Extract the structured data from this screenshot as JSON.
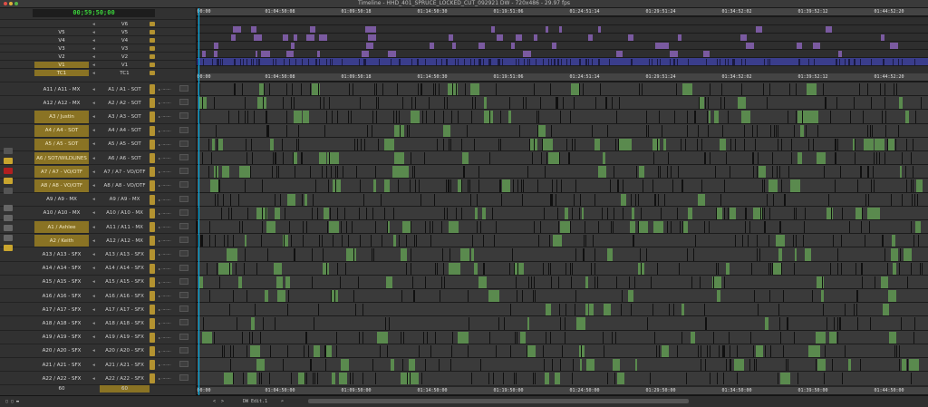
{
  "window": {
    "title": "Timeline - HHD_401_SPRUCE_LOCKED_CUT_092921 DW - 720x486 - 29.97 fps"
  },
  "timecode": "00;59;50;00",
  "ruler_ticks": [
    "00:00",
    "01:04:50:08",
    "01:09:50:18",
    "01:14:50:30",
    "01:19:51:06",
    "01:24:51:14",
    "01:29:51:24",
    "01:34:52:02",
    "01:39:52:12",
    "01:44:52:20"
  ],
  "audio_ruler_ticks": [
    "00:00",
    "01:04:50:08",
    "01:09:50:18",
    "01:14:50:30",
    "01:19:51:06",
    "01:24:51:14",
    "01:29:51:24",
    "01:34:52:02",
    "01:39:52:12",
    "01:44:52:20"
  ],
  "bottom_ruler_ticks": [
    "00:00",
    "01:04:50:00",
    "01:09:50:00",
    "01:14:50:00",
    "01:19:50:00",
    "01:24:50:00",
    "01:29:50:00",
    "01:34:50:00",
    "01:39:50:00",
    "01:44:50:00"
  ],
  "video_tracks": [
    {
      "left": "",
      "right": "V6",
      "gold": false
    },
    {
      "left": "V5",
      "right": "V5",
      "gold": false
    },
    {
      "left": "V4",
      "right": "V4",
      "gold": false
    },
    {
      "left": "V3",
      "right": "V3",
      "gold": false
    },
    {
      "left": "V2",
      "right": "V2",
      "gold": false
    },
    {
      "left": "V1",
      "right": "V1",
      "gold": true
    },
    {
      "left": "TC1",
      "right": "TC1",
      "gold": true
    }
  ],
  "audio_tracks": [
    {
      "left": "A11 / A11 - MX",
      "right": "A1 / A1 - SOT",
      "gold": false,
      "filled": true
    },
    {
      "left": "A12 / A12 - MX",
      "right": "A2 / A2 - SOT",
      "gold": false,
      "filled": true
    },
    {
      "left": "A3 / Justin",
      "right": "A3 / A3 - SOT",
      "gold": true,
      "filled": true
    },
    {
      "left": "A4 / A4 - SOT",
      "right": "A4 / A4 - SOT",
      "gold": true,
      "filled": true
    },
    {
      "left": "A5 / A5 - SOT",
      "right": "A5 / A5 - SOT",
      "gold": true,
      "filled": true
    },
    {
      "left": "A6 / SOT/WILDLINES",
      "right": "A6 / A6 - SOT",
      "gold": true,
      "filled": true
    },
    {
      "left": "A7 / A7 - VO/OTF",
      "right": "A7 / A7 - VO/OTF",
      "gold": true,
      "filled": true
    },
    {
      "left": "A8 / A8 - VO/OTF",
      "right": "A8 / A8 - VO/OTF",
      "gold": true,
      "filled": true
    },
    {
      "left": "A9 / A9 - MX",
      "right": "A9 / A9 - MX",
      "gold": false,
      "filled": true
    },
    {
      "left": "A10 / A10 - MX",
      "right": "A10 / A10 - MX",
      "gold": false,
      "filled": true
    },
    {
      "left": "A1 / Ashlee",
      "right": "A11 / A11 - MX",
      "gold": true,
      "filled": true
    },
    {
      "left": "A2 / Keith",
      "right": "A12 / A12 - MX",
      "gold": true,
      "filled": true
    },
    {
      "left": "A13 / A13 - SFX",
      "right": "A13 / A13 - SFX",
      "gold": false,
      "filled": true
    },
    {
      "left": "A14 / A14 - SFX",
      "right": "A14 / A14 - SFX",
      "gold": false,
      "filled": true
    },
    {
      "left": "A15 / A15 - SFX",
      "right": "A15 / A15 - SFX",
      "gold": false,
      "filled": true
    },
    {
      "left": "A16 / A16 - SFX",
      "right": "A16 / A16 - SFX",
      "gold": false,
      "filled": true
    },
    {
      "left": "A17 / A17 - SFX",
      "right": "A17 / A17 - SFX",
      "gold": false,
      "filled": true
    },
    {
      "left": "A18 / A18 - SFX",
      "right": "A18 / A18 - SFX",
      "gold": false,
      "filled": true
    },
    {
      "left": "A19 / A19 - SFX",
      "right": "A19 / A19 - SFX",
      "gold": false,
      "filled": true
    },
    {
      "left": "A20 / A20 - SFX",
      "right": "A20 / A20 - SFX",
      "gold": false,
      "filled": true
    },
    {
      "left": "A21 / A21 - SFX",
      "right": "A21 / A21 - SFX",
      "gold": false,
      "filled": true
    },
    {
      "left": "A22 / A22 - SFX",
      "right": "A22 / A22 - SFX",
      "gold": false,
      "filled": true
    }
  ],
  "footer_row": {
    "left": "60",
    "right": "60"
  },
  "bottombar": {
    "edit_label": "DW Edit.1",
    "search_icon": "search-icon",
    "zoom_icon": "zoom-icon"
  },
  "colors": {
    "gold": "#8a7324",
    "clip_green": "#5a8a4e",
    "video_blue": "#3a3d8c",
    "playhead": "#00c0ff",
    "timecode_green": "#3bd13b"
  }
}
